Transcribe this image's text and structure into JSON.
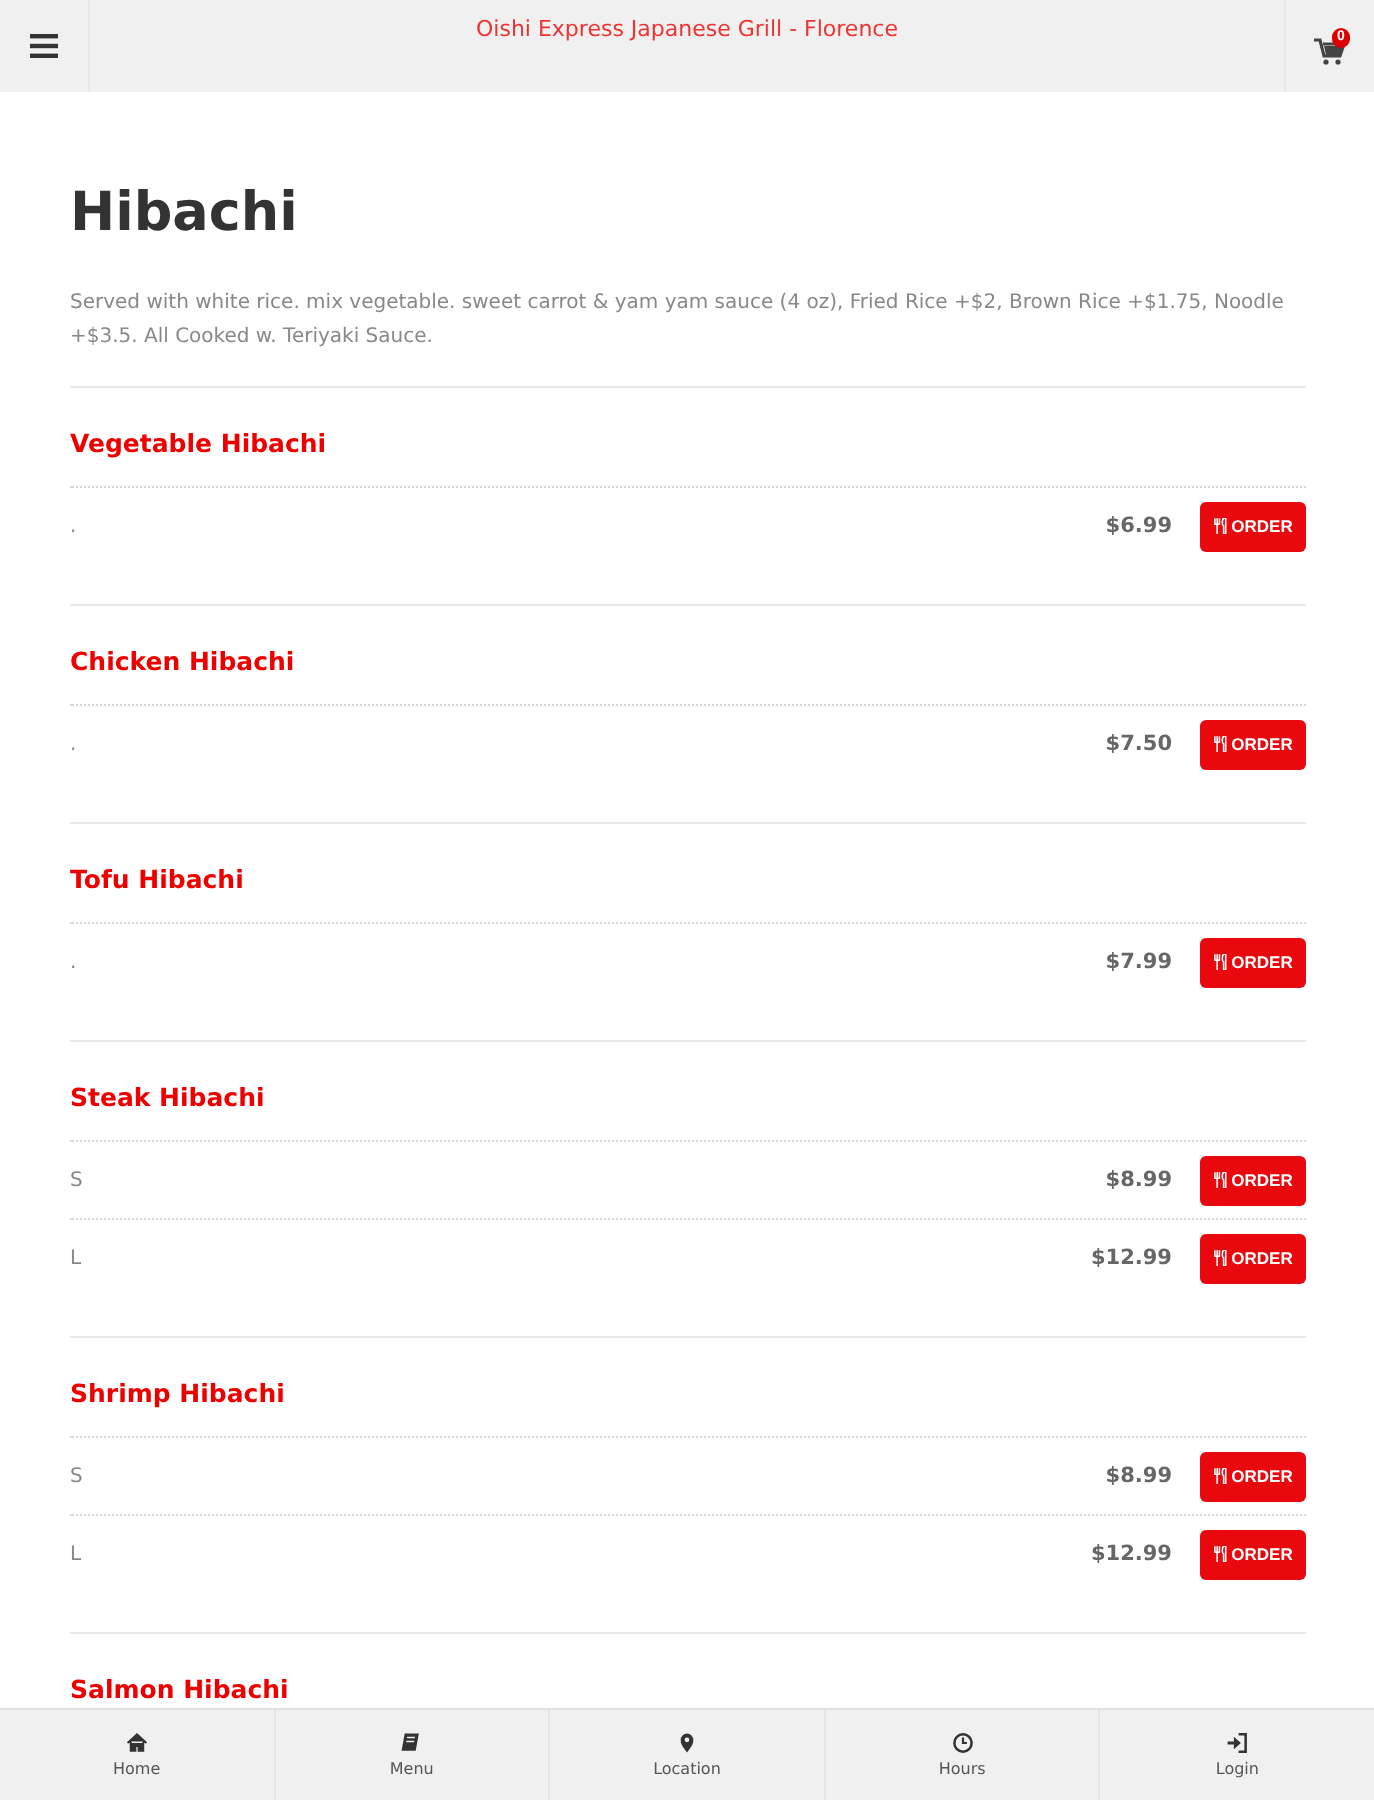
{
  "header": {
    "title": "Oishi Express Japanese Grill - Florence",
    "cart_count": "0"
  },
  "category": {
    "title": "Hibachi",
    "description": "Served with white rice. mix vegetable. sweet carrot & yam yam sauce (4 oz), Fried Rice +$2, Brown Rice +$1.75, Noodle +$3.5. All Cooked w. Teriyaki Sauce."
  },
  "items": [
    {
      "name": "Vegetable Hibachi",
      "options": [
        {
          "label": ".",
          "price": "$6.99",
          "button": "ORDER"
        }
      ]
    },
    {
      "name": "Chicken Hibachi",
      "options": [
        {
          "label": ".",
          "price": "$7.50",
          "button": "ORDER"
        }
      ]
    },
    {
      "name": "Tofu Hibachi",
      "options": [
        {
          "label": ".",
          "price": "$7.99",
          "button": "ORDER"
        }
      ]
    },
    {
      "name": "Steak Hibachi",
      "options": [
        {
          "label": "S",
          "price": "$8.99",
          "button": "ORDER"
        },
        {
          "label": "L",
          "price": "$12.99",
          "button": "ORDER"
        }
      ]
    },
    {
      "name": "Shrimp Hibachi",
      "options": [
        {
          "label": "S",
          "price": "$8.99",
          "button": "ORDER"
        },
        {
          "label": "L",
          "price": "$12.99",
          "button": "ORDER"
        }
      ]
    },
    {
      "name": "Salmon Hibachi"
    }
  ],
  "bottom_nav": [
    {
      "label": "Home",
      "kind": "home"
    },
    {
      "label": "Menu",
      "kind": "menu"
    },
    {
      "label": "Location",
      "kind": "location"
    },
    {
      "label": "Hours",
      "kind": "hours"
    },
    {
      "label": "Login",
      "kind": "login"
    }
  ]
}
